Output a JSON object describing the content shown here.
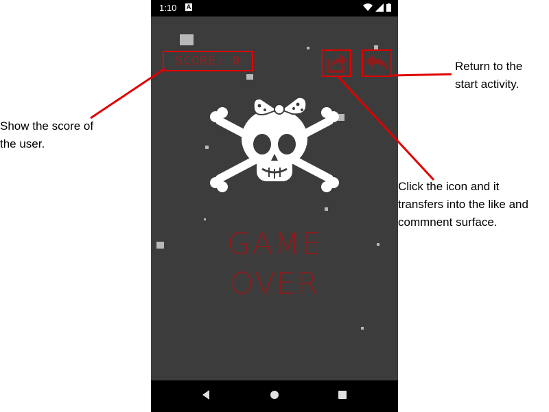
{
  "status_bar": {
    "time": "1:10",
    "notification_glyph": "A",
    "icons": [
      "wifi-icon",
      "signal-icon",
      "battery-icon"
    ]
  },
  "game": {
    "score_label": "SCORE:",
    "score_value": "0",
    "game_over_line1": "GAME",
    "game_over_line2": "OVER",
    "share_icon": "share-icon",
    "back_icon": "back-arrow-icon",
    "center_image": "skull-crossbones-bow-icon"
  },
  "annotations": {
    "score": "Show the score of the user.",
    "share": "Click the icon and it transfers into the like and commnent surface.",
    "back": "Return to the start activity."
  },
  "colors": {
    "annotation_line": "#e00000",
    "game_over_text": "#8e1c1c",
    "background": "#3c3c3c"
  }
}
